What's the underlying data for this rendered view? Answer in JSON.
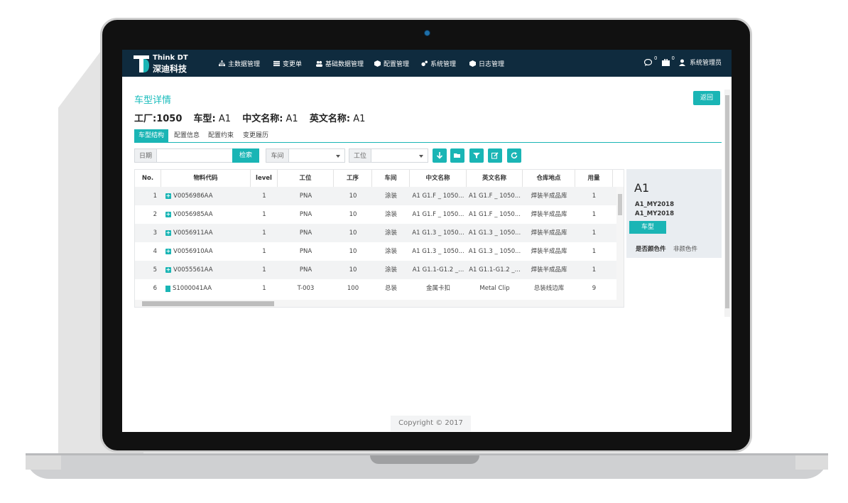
{
  "brand": {
    "line1": "Think DT",
    "line2": "深迪科技",
    "accent": "#1ab5b5",
    "nav_bg": "#0f2b3e"
  },
  "nav": {
    "items": [
      {
        "label": "主数据管理",
        "icon": "sitemap-icon"
      },
      {
        "label": "变更单",
        "icon": "list-icon"
      },
      {
        "label": "基础数据管理",
        "icon": "users-icon"
      },
      {
        "label": "配置管理",
        "icon": "cube-icon"
      },
      {
        "label": "系统管理",
        "icon": "cogs-icon"
      },
      {
        "label": "日志管理",
        "icon": "cube-icon"
      }
    ],
    "message_count": "0",
    "task_count": "0",
    "user": "系统管理员"
  },
  "page": {
    "title": "车型详情",
    "back_label": "返回",
    "info": {
      "factory_label": "工厂:",
      "factory_value": "1050",
      "model_label": "车型:",
      "model_value": "A1",
      "cn_label": "中文名称:",
      "cn_value": "A1",
      "en_label": "英文名称:",
      "en_value": "A1"
    }
  },
  "tabs": [
    "车型结构",
    "配置信息",
    "配置约束",
    "变更履历"
  ],
  "filters": {
    "date_label": "日期",
    "search_label": "检索",
    "workshop_label": "车间",
    "station_label": "工位"
  },
  "table": {
    "headers": [
      "No.",
      "物料代码",
      "level",
      "工位",
      "工序",
      "车间",
      "中文名称",
      "英文名称",
      "仓库地点",
      "用量"
    ],
    "rows": [
      [
        "1",
        "V0056986AA",
        "1",
        "PNA",
        "10",
        "涂装",
        "A1 G1.F _ 1050...",
        "A1 G1.F _ 1050...",
        "焊装半成品库",
        "1"
      ],
      [
        "2",
        "V0056985AA",
        "1",
        "PNA",
        "10",
        "涂装",
        "A1 G1.F _ 1050...",
        "A1 G1.F _ 1050...",
        "焊装半成品库",
        "1"
      ],
      [
        "3",
        "V0056911AA",
        "1",
        "PNA",
        "10",
        "涂装",
        "A1 G1.3 _ 1050...",
        "A1 G1.3 _ 1050...",
        "焊装半成品库",
        "1"
      ],
      [
        "4",
        "V0056910AA",
        "1",
        "PNA",
        "10",
        "涂装",
        "A1 G1.3 _ 1050...",
        "A1 G1.3 _ 1050...",
        "焊装半成品库",
        "1"
      ],
      [
        "5",
        "V0055561AA",
        "1",
        "PNA",
        "10",
        "涂装",
        "A1 G1.1-G1.2 _...",
        "A1 G1.1-G1.2 _...",
        "焊装半成品库",
        "1"
      ],
      [
        "6",
        "S1000041AA",
        "1",
        "T-003",
        "100",
        "总装",
        "金属卡扣",
        "Metal Clip",
        "总装线边库",
        "9"
      ]
    ],
    "row_icons": [
      "plus-square-icon",
      "plus-square-icon",
      "plus-square-icon",
      "plus-square-icon",
      "plus-square-icon",
      "file-icon"
    ]
  },
  "side": {
    "title": "A1",
    "line1": "A1_MY2018",
    "line2": "A1_MY2018",
    "button": "车型",
    "color_label": "是否颜色件",
    "color_value": "非颜色件"
  },
  "footer": {
    "copyright": "Copyright © 2017"
  }
}
